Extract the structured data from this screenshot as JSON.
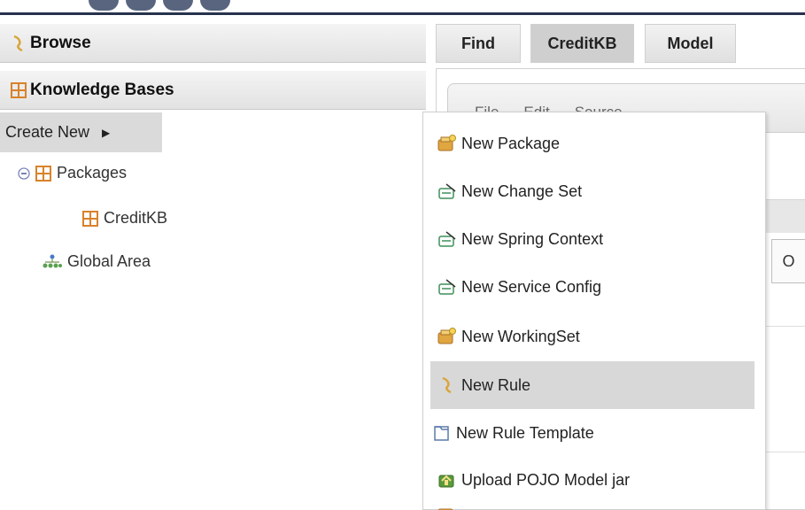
{
  "nav": {
    "browse_label": "Browse",
    "knowledge_bases_label": "Knowledge Bases",
    "create_new_label": "Create New",
    "tree": {
      "packages_label": "Packages",
      "creditkb_label": "CreditKB",
      "global_area_label": "Global Area"
    }
  },
  "tabs": [
    {
      "label": "Find"
    },
    {
      "label": "CreditKB",
      "selected": true
    },
    {
      "label": "Model"
    }
  ],
  "toolbar": {
    "file": "File",
    "edit": "Edit",
    "source": "Source"
  },
  "panel": {
    "box_text": "O"
  },
  "menu": {
    "items": [
      {
        "label": "New Package",
        "icon": "package-icon"
      },
      {
        "label": "New Change Set",
        "icon": "change-set-icon"
      },
      {
        "label": "New Spring Context",
        "icon": "spring-context-icon"
      },
      {
        "label": "New Service Config",
        "icon": "service-config-icon"
      },
      {
        "label": "New WorkingSet",
        "icon": "workingset-icon"
      },
      {
        "label": "New Rule",
        "icon": "rule-icon",
        "highlighted": true
      },
      {
        "label": "New Rule Template",
        "icon": "rule-template-icon"
      },
      {
        "label": "Upload POJO Model jar",
        "icon": "upload-jar-icon"
      }
    ]
  },
  "colors": {
    "accent_dark": "#27324d",
    "highlight": "#d8d8d8",
    "package_orange": "#d9822b"
  }
}
